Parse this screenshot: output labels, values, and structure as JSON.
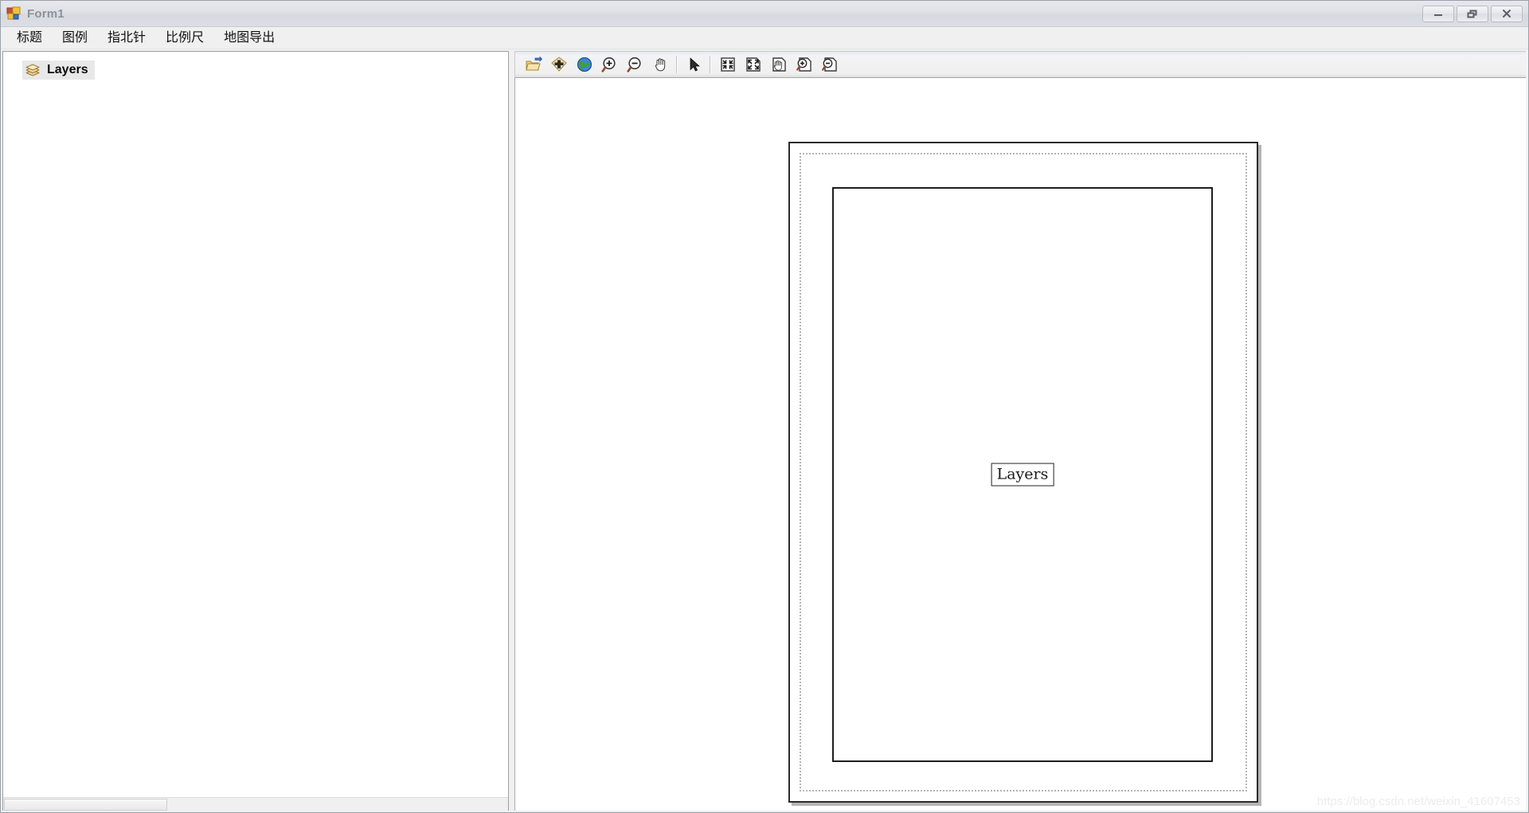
{
  "window": {
    "title": "Form1",
    "app_icon": "winforms-icon",
    "controls": [
      {
        "name": "minimize",
        "icon": "minimize-icon",
        "label": "—"
      },
      {
        "name": "restore",
        "icon": "restore-icon",
        "label": "❐"
      },
      {
        "name": "close",
        "icon": "close-icon",
        "label": "✕"
      }
    ]
  },
  "menubar": {
    "items": [
      {
        "id": "title",
        "label": "标题"
      },
      {
        "id": "legend",
        "label": "图例"
      },
      {
        "id": "north-arrow",
        "label": "指北针"
      },
      {
        "id": "scale-bar",
        "label": "比例尺"
      },
      {
        "id": "map-export",
        "label": "地图导出"
      }
    ]
  },
  "layers_panel": {
    "root": {
      "label": "Layers",
      "icon": "layers-stack-icon",
      "selected": true
    }
  },
  "toolbar": {
    "buttons": [
      {
        "id": "open-data",
        "icon": "open-folder-icon",
        "tooltip": "Add Data"
      },
      {
        "id": "add-layer",
        "icon": "add-plus-diamond-icon",
        "tooltip": "Add Layer"
      },
      {
        "id": "full-extent-globe",
        "icon": "globe-icon",
        "tooltip": "Full Extent"
      },
      {
        "id": "zoom-in",
        "icon": "zoom-in-icon",
        "tooltip": "Zoom In"
      },
      {
        "id": "zoom-out",
        "icon": "zoom-out-icon",
        "tooltip": "Zoom Out"
      },
      {
        "id": "pan",
        "icon": "pan-hand-icon",
        "tooltip": "Pan"
      },
      {
        "id": "select",
        "icon": "arrow-pointer-icon",
        "tooltip": "Select"
      },
      {
        "id": "page-fit",
        "icon": "page-fit-inward-icon",
        "tooltip": "Fit Page"
      },
      {
        "id": "page-expand",
        "icon": "page-expand-outward-icon",
        "tooltip": "Expand Page"
      },
      {
        "id": "page-pan",
        "icon": "page-pan-hand-icon",
        "tooltip": "Pan Page"
      },
      {
        "id": "page-zoom-in",
        "icon": "page-zoom-in-icon",
        "tooltip": "Zoom In Page"
      },
      {
        "id": "page-zoom-out",
        "icon": "page-zoom-out-icon",
        "tooltip": "Zoom Out Page"
      }
    ]
  },
  "layout_view": {
    "page": {
      "orientation": "portrait",
      "map_frame": {
        "title_box": {
          "text": "Layers"
        }
      }
    }
  },
  "watermark": {
    "text": "https://blog.csdn.net/weixin_41607453"
  },
  "colors": {
    "titlebar_text": "#8d9298",
    "page_border": "#2b2b2b",
    "frame_border": "#1e1e1e",
    "selection_bg": "#e8e8e8",
    "toolbar_bg": "#f0f0f0"
  }
}
